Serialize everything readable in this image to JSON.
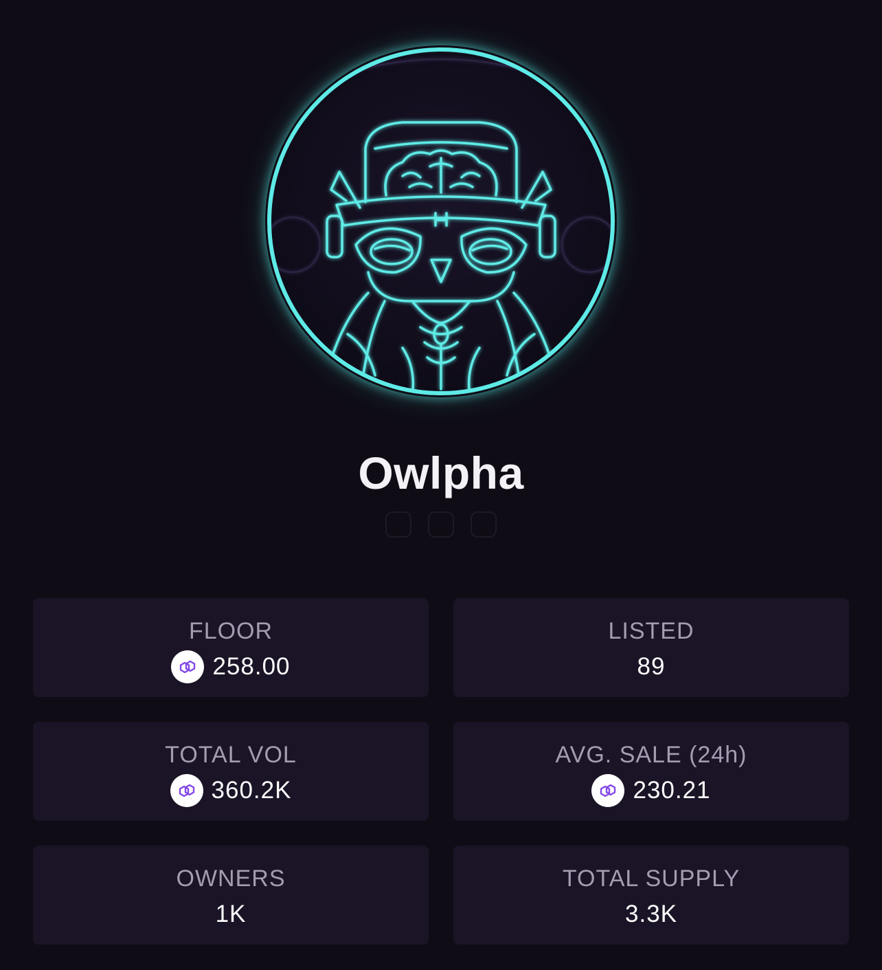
{
  "collection": {
    "name": "Owlpha",
    "avatar_icon": "owl-avatar",
    "accent_color": "#5eeae6"
  },
  "social_links": [
    {
      "icon": "social-link-1"
    },
    {
      "icon": "social-link-2"
    },
    {
      "icon": "social-link-3"
    }
  ],
  "stats": {
    "floor": {
      "label": "FLOOR",
      "value": "258.00",
      "currency_icon": "polygon-icon"
    },
    "listed": {
      "label": "LISTED",
      "value": "89"
    },
    "total_vol": {
      "label": "TOTAL VOL",
      "value": "360.2K",
      "currency_icon": "polygon-icon"
    },
    "avg_sale": {
      "label": "AVG. SALE (24h)",
      "value": "230.21",
      "currency_icon": "polygon-icon"
    },
    "owners": {
      "label": "OWNERS",
      "value": "1K"
    },
    "total_supply": {
      "label": "TOTAL SUPPLY",
      "value": "3.3K"
    }
  },
  "colors": {
    "background": "#0f0c15",
    "card": "#1b1426",
    "label": "#a49db2",
    "polygon_purple": "#8247e5"
  }
}
